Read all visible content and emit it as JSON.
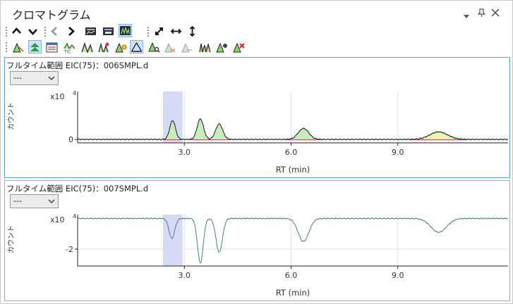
{
  "window": {
    "title": "クロマトグラム",
    "controls": {
      "dropdown_icon": "dropdown-arrow-icon",
      "pin_icon": "pin-icon",
      "close_icon": "close-icon"
    }
  },
  "toolbar_row1": [
    "arrow-up-icon",
    "arrow-down-icon",
    "arrow-left-icon",
    "arrow-right-icon",
    "auto-scale-icon",
    "overlay-icon",
    "split-pane-icon",
    "expand-diagonal-icon",
    "expand-horizontal-icon",
    "expand-vertical-icon"
  ],
  "toolbar_row2": [
    "peak-integrate-icon",
    "peak-split-icon",
    "list-table-icon",
    "tic-icon",
    "smooth-icon",
    "spectrum-icon",
    "peak-label-icon",
    "baseline-icon",
    "peak-zoom-icon",
    "peak-hide-icon",
    "peak-gray-icon",
    "noise-icon",
    "peak-sync-icon",
    "peak-delete-icon"
  ],
  "colors": {
    "pane_active_border": "#4e9ed9",
    "highlight_band": "#d6daf7",
    "trace_pos": "#1a1a1a",
    "trace_neg": "#4a7e86",
    "peak_fill_green": "#c8ecbe",
    "peak_fill_yellow": "#f2efb2",
    "baseline_red": "#d23a3a",
    "grid": "#e2e2e2"
  },
  "panes": [
    {
      "title": "フルタイム範囲 EIC(75)：006SMPL.d",
      "selector_value": "---",
      "y_axis_label": "カウント",
      "chart_data": {
        "type": "line",
        "x_label": "RT (min)",
        "x_ticks": [
          "3.0",
          "6.0",
          "9.0"
        ],
        "x_tick_values": [
          3.0,
          6.0,
          9.0
        ],
        "x_range": [
          0.0,
          12.1
        ],
        "y_multiplier": "x10",
        "y_exponent": "4",
        "y_ticks": [
          "0"
        ],
        "y_tick_values": [
          0
        ],
        "y_range": [
          -0.1,
          1.4
        ],
        "highlight_band": [
          2.4,
          2.95
        ],
        "peaks": [
          {
            "rt": 2.67,
            "height": 0.55,
            "width": 0.08,
            "fill": "green"
          },
          {
            "rt": 3.45,
            "height": 0.6,
            "width": 0.09,
            "fill": "green"
          },
          {
            "rt": 3.98,
            "height": 0.45,
            "width": 0.1,
            "fill": "green"
          },
          {
            "rt": 6.35,
            "height": 0.32,
            "width": 0.15,
            "fill": "green"
          },
          {
            "rt": 10.15,
            "height": 0.22,
            "width": 0.25,
            "fill": "yellow"
          }
        ]
      }
    },
    {
      "title": "フルタイム範囲 EIC(75)：007SMPL.d",
      "selector_value": "---",
      "y_axis_label": "カウント",
      "chart_data": {
        "type": "line",
        "x_label": "RT (min)",
        "x_ticks": [
          "3.0",
          "6.0",
          "9.0"
        ],
        "x_tick_values": [
          3.0,
          6.0,
          9.0
        ],
        "x_range": [
          0.0,
          12.1
        ],
        "y_multiplier": "x10",
        "y_exponent": "4",
        "y_ticks": [
          "-2"
        ],
        "y_tick_values": [
          -2
        ],
        "y_range": [
          -3.1,
          0.25
        ],
        "baseline": 0.0,
        "highlight_band": [
          2.4,
          2.95
        ],
        "peaks": [
          {
            "rt": 2.65,
            "height": -1.3,
            "width": 0.08
          },
          {
            "rt": 3.45,
            "height": -2.9,
            "width": 0.08
          },
          {
            "rt": 3.98,
            "height": -2.2,
            "width": 0.09
          },
          {
            "rt": 6.35,
            "height": -1.5,
            "width": 0.15
          },
          {
            "rt": 10.15,
            "height": -0.9,
            "width": 0.22
          }
        ]
      }
    }
  ]
}
